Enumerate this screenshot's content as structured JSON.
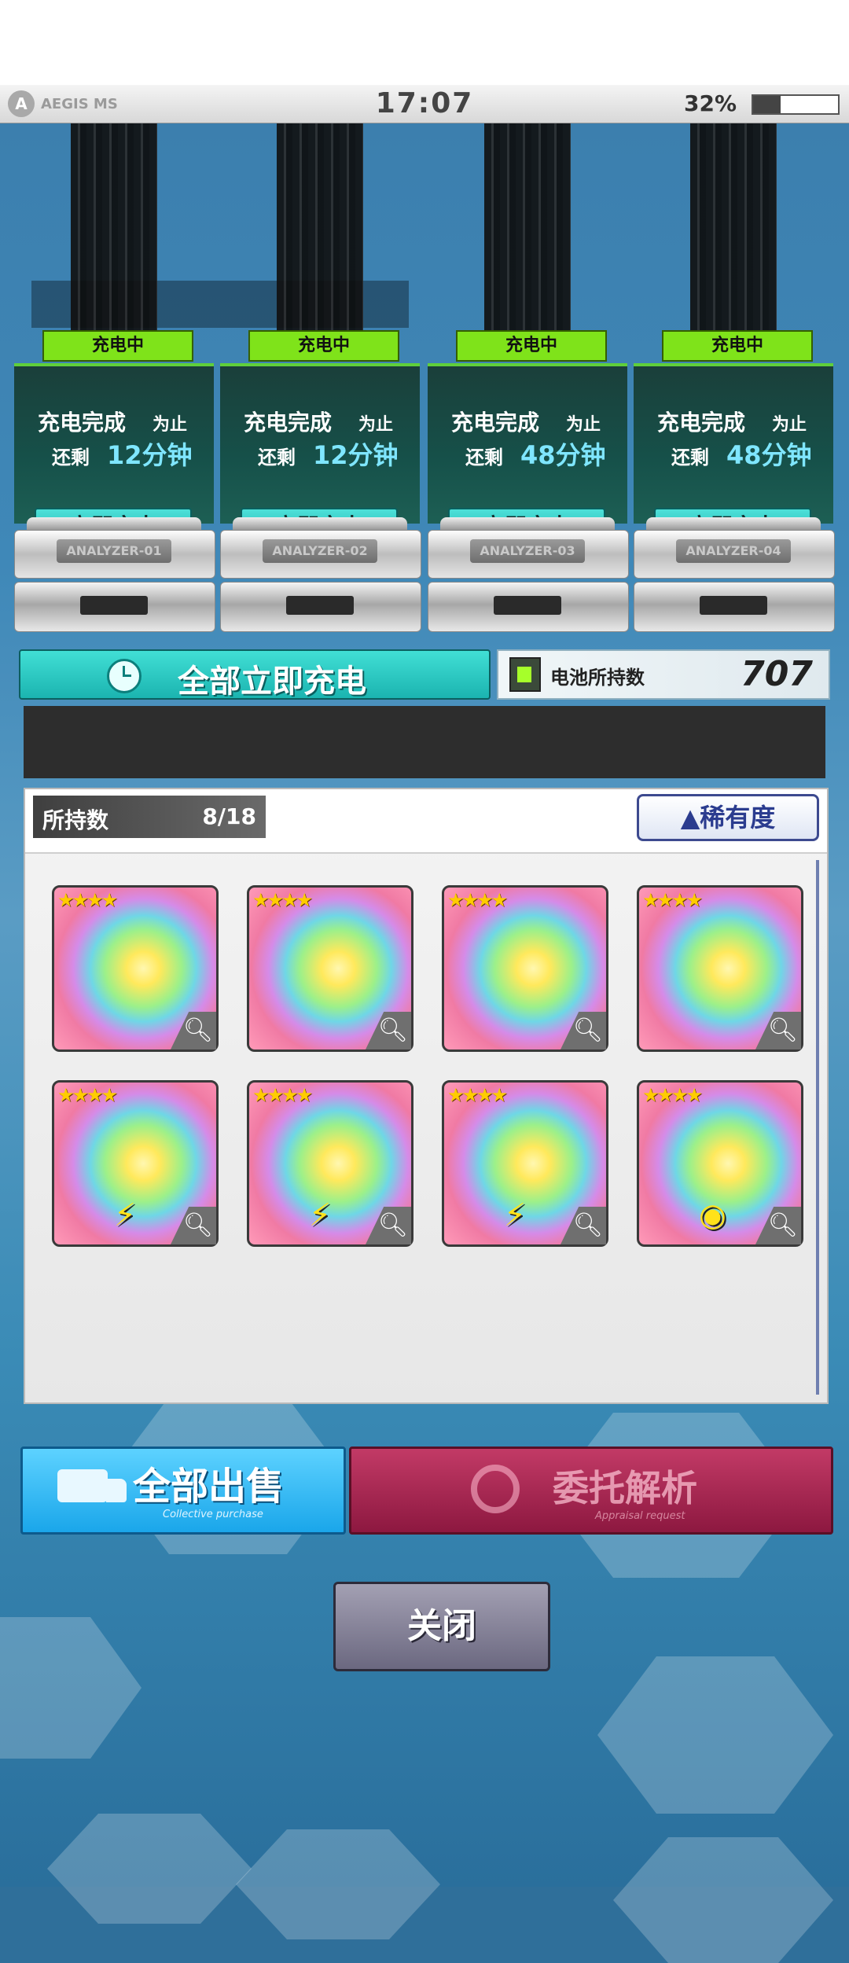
{
  "status_bar": {
    "logo_text": "AEGIS MS",
    "time": "17:07",
    "battery_percent": "32%",
    "battery_level": 0.32
  },
  "analyzers": [
    {
      "status": "充电中",
      "done_label": "充电完成",
      "until_label": "为止",
      "remaining_label": "还剩",
      "remaining": "12分钟",
      "charge_button": "立即充电",
      "name": "ANALYZER-01"
    },
    {
      "status": "充电中",
      "done_label": "充电完成",
      "until_label": "为止",
      "remaining_label": "还剩",
      "remaining": "12分钟",
      "charge_button": "立即充电",
      "name": "ANALYZER-02"
    },
    {
      "status": "充电中",
      "done_label": "充电完成",
      "until_label": "为止",
      "remaining_label": "还剩",
      "remaining": "48分钟",
      "charge_button": "立即充电",
      "name": "ANALYZER-03"
    },
    {
      "status": "充电中",
      "done_label": "充电完成",
      "until_label": "为止",
      "remaining_label": "还剩",
      "remaining": "48分钟",
      "charge_button": "立即充电",
      "name": "ANALYZER-04"
    }
  ],
  "charge_all_label": "全部立即充电",
  "battery_held": {
    "label": "电池所持数",
    "value": "707"
  },
  "inventory": {
    "count_label": "所持数",
    "count_value": "8/18",
    "sort_label": "▲稀有度",
    "items": [
      {
        "stars": "★★★★",
        "element": ""
      },
      {
        "stars": "★★★★",
        "element": ""
      },
      {
        "stars": "★★★★",
        "element": ""
      },
      {
        "stars": "★★★★",
        "element": ""
      },
      {
        "stars": "★★★★",
        "element": "⚡"
      },
      {
        "stars": "★★★★",
        "element": "⚡"
      },
      {
        "stars": "★★★★",
        "element": "⚡"
      },
      {
        "stars": "★★★★",
        "element": "◉"
      }
    ]
  },
  "sell_all": {
    "label": "全部出售",
    "sub": "Collective purchase"
  },
  "appraise": {
    "label": "委托解析",
    "sub": "Appraisal request"
  },
  "close_label": "关闭",
  "icons": {
    "search": "magnifier-icon",
    "clock": "clock-icon",
    "truck": "truck-icon"
  }
}
